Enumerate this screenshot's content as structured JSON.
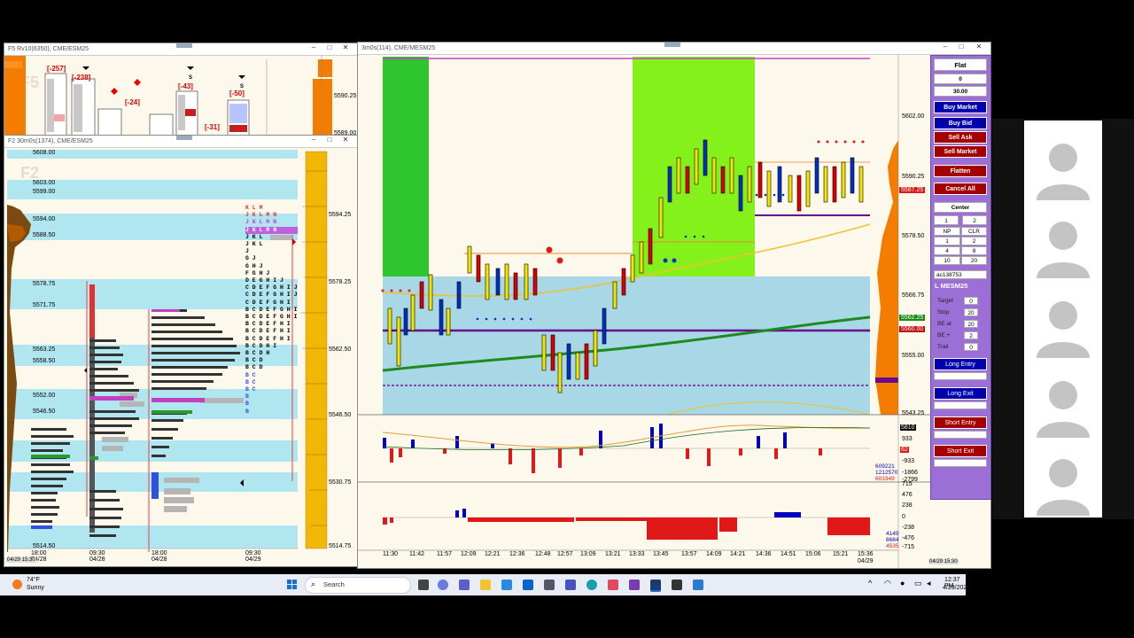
{
  "windows": {
    "f5": {
      "title": "F5 Rv10(6350), CME/ESM25",
      "watermark": "F5",
      "deltas": [
        "[-257]",
        "[-238]",
        "[-24]",
        "[-43]",
        "[-50]",
        "[-31]"
      ],
      "prices": [
        "5590.25",
        "5589.00"
      ]
    },
    "f2": {
      "title": "F2 30m0s(1374), CME/ESM25",
      "watermark": "F2",
      "price_levels": [
        "5608.00",
        "5603.00",
        "5599.00",
        "5594.00",
        "5588.50",
        "5578.75",
        "5571.75",
        "5563.25",
        "5558.50",
        "5552.00",
        "5546.50",
        "5514.50"
      ],
      "axis_prices": [
        "5594.25",
        "5578.25",
        "5562.50",
        "5546.50",
        "5530.75",
        "5514.75"
      ],
      "x_labels": [
        "18:00",
        "09:30",
        "18:00",
        "09:30"
      ],
      "x_dates": [
        "04/28",
        "04/28",
        "04/28",
        "04/29"
      ],
      "corner_date": "04/29 15:30",
      "profile_rows": [
        "K L M",
        "J K L M N",
        "J K L M N",
        "J K L M N",
        "J K L",
        "J K L",
        "J",
        "G J",
        "G H J",
        "F G H J",
        "D E G H I J",
        "C D E F G H I J",
        "C D E F G H I J",
        "C D E F G H I",
        "B C D E F G H I",
        "B C D E F G H I",
        "B C D E F H I",
        "B C D E F H I",
        "B C D E F H I",
        "B C D H I",
        "B C D H",
        "B C D",
        "B C D",
        "B C",
        "B C",
        "B C",
        "B",
        "B",
        "B"
      ]
    },
    "main": {
      "title": "3m0s(114), CME/MESM25",
      "price_axis": [
        "5602.00",
        "5590.25",
        "5578.50",
        "5566.75",
        "5555.00",
        "5543.25"
      ],
      "price_tags": [
        {
          "text": "5587.25",
          "color": "#e01818"
        },
        {
          "text": "5562.25",
          "color": "#1a8a1a"
        },
        {
          "text": "5560.00",
          "color": "#c01010"
        }
      ],
      "indicator1_axis": [
        "5810",
        "933",
        "62",
        "-933",
        "-1866",
        "-2799"
      ],
      "indicator1_tags": [
        "609221",
        "1212570",
        "603349"
      ],
      "indicator2_axis": [
        "715",
        "476",
        "238",
        "0",
        "-238",
        "-476",
        "-715"
      ],
      "indicator2_tags": [
        "4149",
        "8684",
        "4535"
      ],
      "time_labels": [
        "11:30",
        "11:42",
        "11:57",
        "12:09",
        "12:21",
        "12:36",
        "12:48",
        "12:57",
        "13:09",
        "13:21",
        "13:33",
        "13:45",
        "13:57",
        "14:09",
        "14:21",
        "14:36",
        "14:51",
        "15:06",
        "15:21",
        "15:36"
      ],
      "last_date": "04/29",
      "corner_date": "04/29 15:30"
    }
  },
  "order_panel": {
    "position": "Flat",
    "qty": "0",
    "price": "30.00",
    "buy_market": "Buy Market",
    "buy_bid": "Buy Bid",
    "sell_ask": "Sell Ask",
    "sell_market": "Sell Market",
    "flatten": "Flatten",
    "cancel_all": "Cancel All",
    "center": "Center",
    "qty_inputs": [
      "1",
      "2"
    ],
    "grid": [
      "NP",
      "CLR",
      "1",
      "2",
      "4",
      "8",
      "10",
      "20"
    ],
    "account": "ac138753",
    "strategy": "L MESM25",
    "fields": [
      {
        "label": "Target",
        "value": "0"
      },
      {
        "label": "Stop",
        "value": "20"
      },
      {
        "label": "BE at",
        "value": "20"
      },
      {
        "label": "BE +",
        "value": "2"
      },
      {
        "label": "Trail",
        "value": "0"
      }
    ],
    "long_entry": "Long Entry",
    "long_exit": "Long Exit",
    "short_entry": "Short Entry",
    "short_exit": "Short Exit"
  },
  "taskbar": {
    "weather_temp": "74°F",
    "weather_desc": "Sunny",
    "search_placeholder": "Search",
    "time": "12:37 PM",
    "date": "4/29/2025"
  },
  "colors": {
    "green_zone": "#2fc52f",
    "lime_zone": "#84f21a",
    "value_area": "#a8d7e6",
    "sell_red": "#a50000",
    "buy_blue": "#0000b0"
  }
}
